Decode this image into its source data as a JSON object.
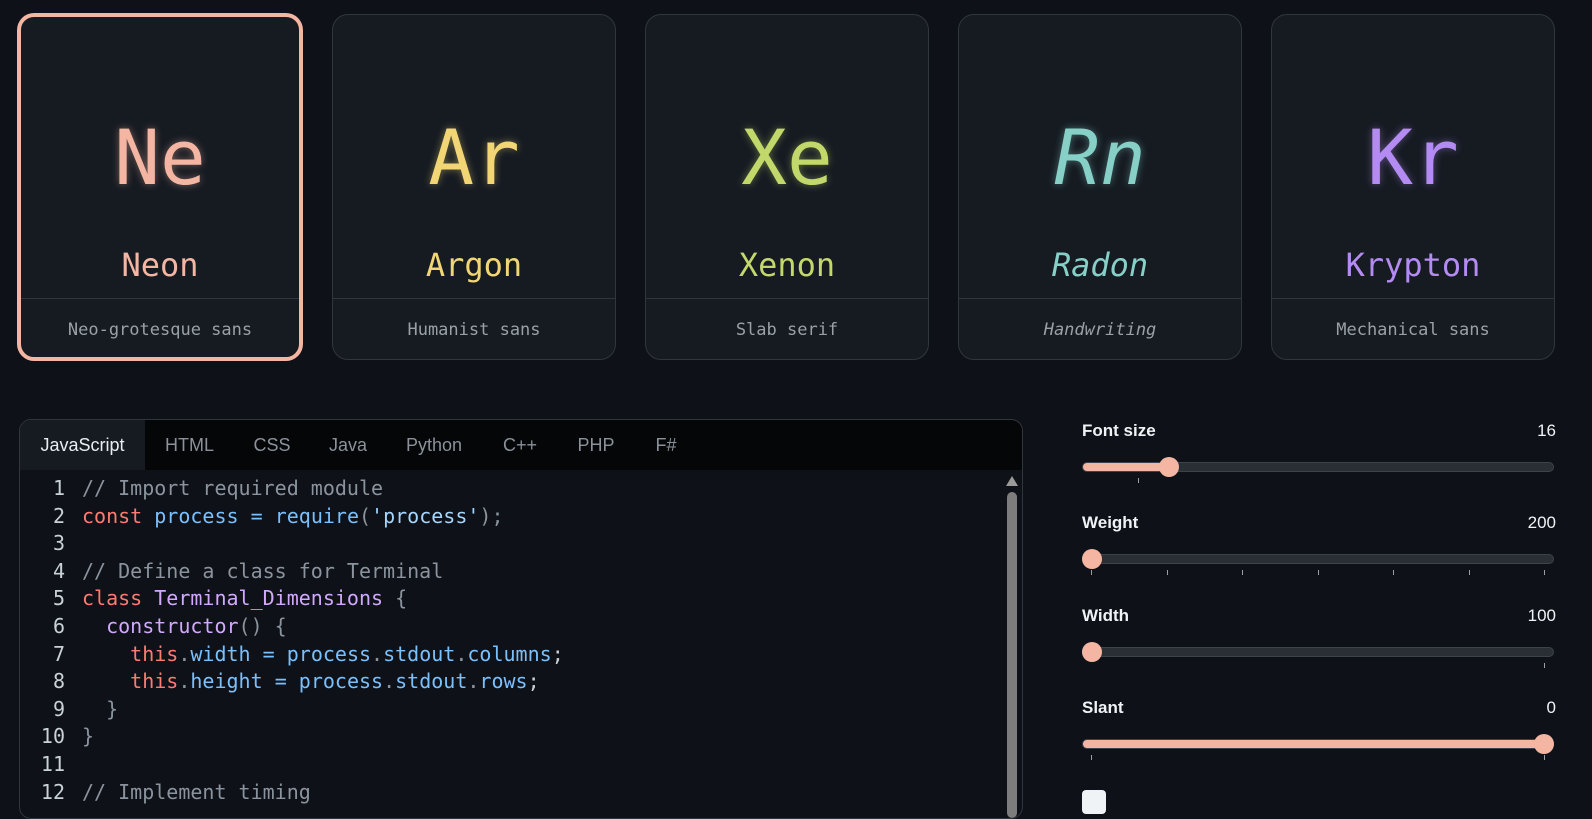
{
  "cards": [
    {
      "symbol": "Ne",
      "name": "Neon",
      "desc": "Neo-grotesque sans",
      "color": "#f4b6a2",
      "selected": true
    },
    {
      "symbol": "Ar",
      "name": "Argon",
      "desc": "Humanist sans",
      "color": "#f2d675",
      "selected": false
    },
    {
      "symbol": "Xe",
      "name": "Xenon",
      "desc": "Slab serif",
      "color": "#c2d86b",
      "selected": false
    },
    {
      "symbol": "Rn",
      "name": "Radon",
      "desc": "Handwriting",
      "color": "#86d0c8",
      "selected": false
    },
    {
      "symbol": "Kr",
      "name": "Krypton",
      "desc": "Mechanical sans",
      "color": "#b48bf2",
      "selected": false
    }
  ],
  "tabs": [
    "JavaScript",
    "HTML",
    "CSS",
    "Java",
    "Python",
    "C++",
    "PHP",
    "F#"
  ],
  "active_tab": "JavaScript",
  "code_lines": [
    {
      "n": "1",
      "parts": [
        [
          "cm",
          "// Import required module"
        ]
      ]
    },
    {
      "n": "2",
      "parts": [
        [
          "kw",
          "const"
        ],
        [
          "pl",
          " "
        ],
        [
          "fn",
          "process"
        ],
        [
          "pl",
          " "
        ],
        [
          "fn",
          "="
        ],
        [
          "pl",
          " "
        ],
        [
          "fn",
          "require"
        ],
        [
          "pu",
          "("
        ],
        [
          "st",
          "'process'"
        ],
        [
          "pu",
          ");"
        ]
      ]
    },
    {
      "n": "3",
      "parts": []
    },
    {
      "n": "4",
      "parts": [
        [
          "cm",
          "// Define a class for Terminal"
        ]
      ]
    },
    {
      "n": "5",
      "parts": [
        [
          "kw",
          "class"
        ],
        [
          "pl",
          " "
        ],
        [
          "cl",
          "Terminal_Dimensions"
        ],
        [
          "pl",
          " "
        ],
        [
          "pu",
          "{"
        ]
      ]
    },
    {
      "n": "6",
      "parts": [
        [
          "pl",
          "  "
        ],
        [
          "cl",
          "constructor"
        ],
        [
          "pu",
          "() {"
        ]
      ]
    },
    {
      "n": "7",
      "parts": [
        [
          "pl",
          "    "
        ],
        [
          "th",
          "this"
        ],
        [
          "pu",
          "."
        ],
        [
          "pr",
          "width"
        ],
        [
          "pl",
          " "
        ],
        [
          "fn",
          "="
        ],
        [
          "pl",
          " "
        ],
        [
          "fn",
          "process"
        ],
        [
          "pu",
          "."
        ],
        [
          "fn",
          "stdout"
        ],
        [
          "pu",
          "."
        ],
        [
          "fn",
          "columns"
        ],
        [
          "pl",
          ";"
        ]
      ]
    },
    {
      "n": "8",
      "parts": [
        [
          "pl",
          "    "
        ],
        [
          "th",
          "this"
        ],
        [
          "pu",
          "."
        ],
        [
          "pr",
          "height"
        ],
        [
          "pl",
          " "
        ],
        [
          "fn",
          "="
        ],
        [
          "pl",
          " "
        ],
        [
          "fn",
          "process"
        ],
        [
          "pu",
          "."
        ],
        [
          "fn",
          "stdout"
        ],
        [
          "pu",
          "."
        ],
        [
          "fn",
          "rows"
        ],
        [
          "pl",
          ";"
        ]
      ]
    },
    {
      "n": "9",
      "parts": [
        [
          "pl",
          "  "
        ],
        [
          "pu",
          "}"
        ]
      ]
    },
    {
      "n": "10",
      "parts": [
        [
          "pu",
          "}"
        ]
      ]
    },
    {
      "n": "11",
      "parts": []
    },
    {
      "n": "12",
      "parts": [
        [
          "cm",
          "// Implement timing"
        ]
      ]
    }
  ],
  "controls": [
    {
      "label": "Font size",
      "value": "16",
      "fraction": 0.17
    },
    {
      "label": "Weight",
      "value": "200",
      "fraction": 0.0
    },
    {
      "label": "Width",
      "value": "100",
      "fraction": 0.0
    },
    {
      "label": "Slant",
      "value": "0",
      "fraction": 1.0
    }
  ]
}
